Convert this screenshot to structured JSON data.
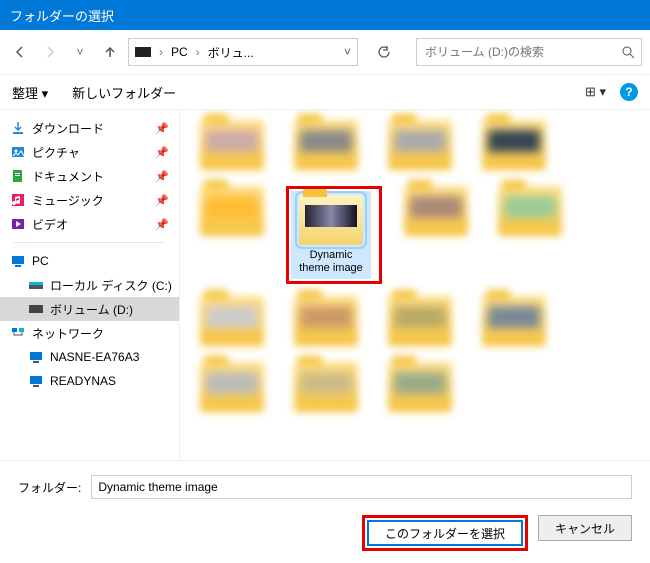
{
  "title": "フォルダーの選択",
  "nav": {
    "back": "←",
    "forward": "→",
    "recent": "˅",
    "up": "↑"
  },
  "address": {
    "crumbs": [
      "PC",
      "ボリュ..."
    ],
    "dropdown": "˅",
    "refresh": "↻"
  },
  "search": {
    "placeholder": "ボリューム (D:)の検索"
  },
  "toolbar": {
    "organize": "整理 ▾",
    "newfolder": "新しいフォルダー",
    "view": "⊞ ▾",
    "help": "?"
  },
  "tree": {
    "quick": [
      {
        "label": "ダウンロード",
        "icon": "download",
        "pin": true
      },
      {
        "label": "ピクチャ",
        "icon": "pictures",
        "pin": true
      },
      {
        "label": "ドキュメント",
        "icon": "documents",
        "pin": true
      },
      {
        "label": "ミュージック",
        "icon": "music",
        "pin": true
      },
      {
        "label": "ビデオ",
        "icon": "video",
        "pin": true
      }
    ],
    "pc_label": "PC",
    "drives": [
      {
        "label": "ローカル ディスク (C:)"
      },
      {
        "label": "ボリューム (D:)",
        "selected": true
      }
    ],
    "network_label": "ネットワーク",
    "network": [
      {
        "label": "NASNE-EA76A3"
      },
      {
        "label": "READYNAS"
      }
    ]
  },
  "content": {
    "selected_folder_label": "Dynamic theme image"
  },
  "footer": {
    "label": "フォルダー:",
    "value": "Dynamic theme image",
    "select_btn": "このフォルダーを選択",
    "cancel_btn": "キャンセル"
  }
}
